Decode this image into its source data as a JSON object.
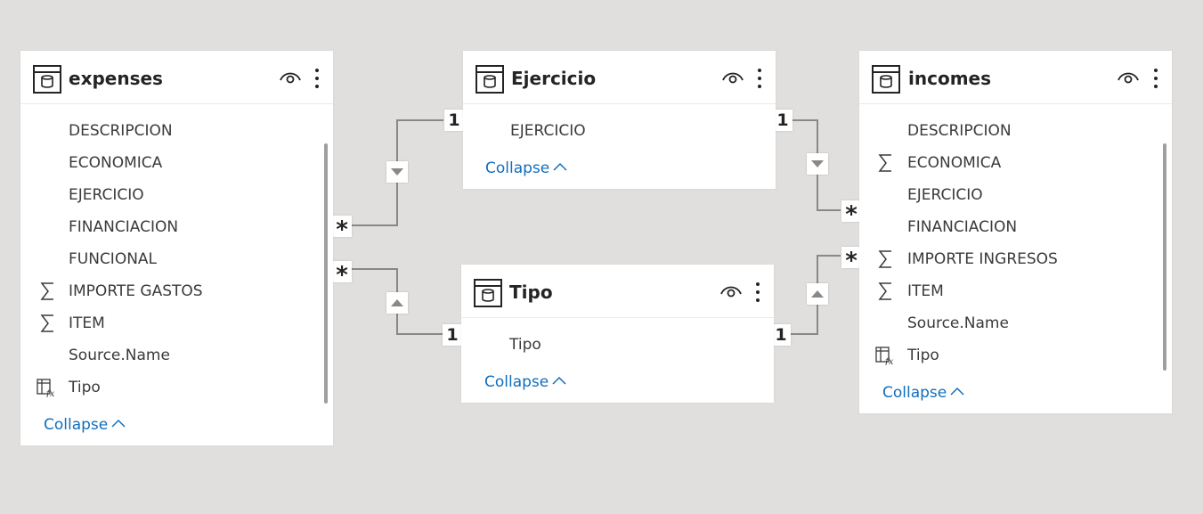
{
  "tables": {
    "expenses": {
      "title": "expenses",
      "fields": [
        "DESCRIPCION",
        "ECONOMICA",
        "EJERCICIO",
        "FINANCIACION",
        "FUNCIONAL",
        "IMPORTE GASTOS",
        "ITEM",
        "Source.Name",
        "Tipo"
      ],
      "collapse_label": "Collapse"
    },
    "ejercicio": {
      "title": "Ejercicio",
      "fields": [
        "EJERCICIO"
      ],
      "collapse_label": "Collapse"
    },
    "tipo": {
      "title": "Tipo",
      "fields": [
        "Tipo"
      ],
      "collapse_label": "Collapse"
    },
    "incomes": {
      "title": "incomes",
      "fields": [
        "DESCRIPCION",
        "ECONOMICA",
        "EJERCICIO",
        "FINANCIACION",
        "IMPORTE INGRESOS",
        "ITEM",
        "Source.Name",
        "Tipo"
      ],
      "collapse_label": "Collapse"
    }
  },
  "relationships": {
    "one": "1",
    "many": "*"
  },
  "icons": {
    "table": "table-icon",
    "visibility": "eye-icon",
    "more": "more-options-icon",
    "sum": "sigma-icon",
    "calculated": "calculated-column-icon",
    "collapse": "chevron-up-icon",
    "filter_down": "triangle-down-icon",
    "filter_up": "triangle-up-icon"
  },
  "colors": {
    "canvas": "#e1dfdd",
    "card": "#ffffff",
    "link": "#106ebe",
    "line": "#8a8886"
  }
}
